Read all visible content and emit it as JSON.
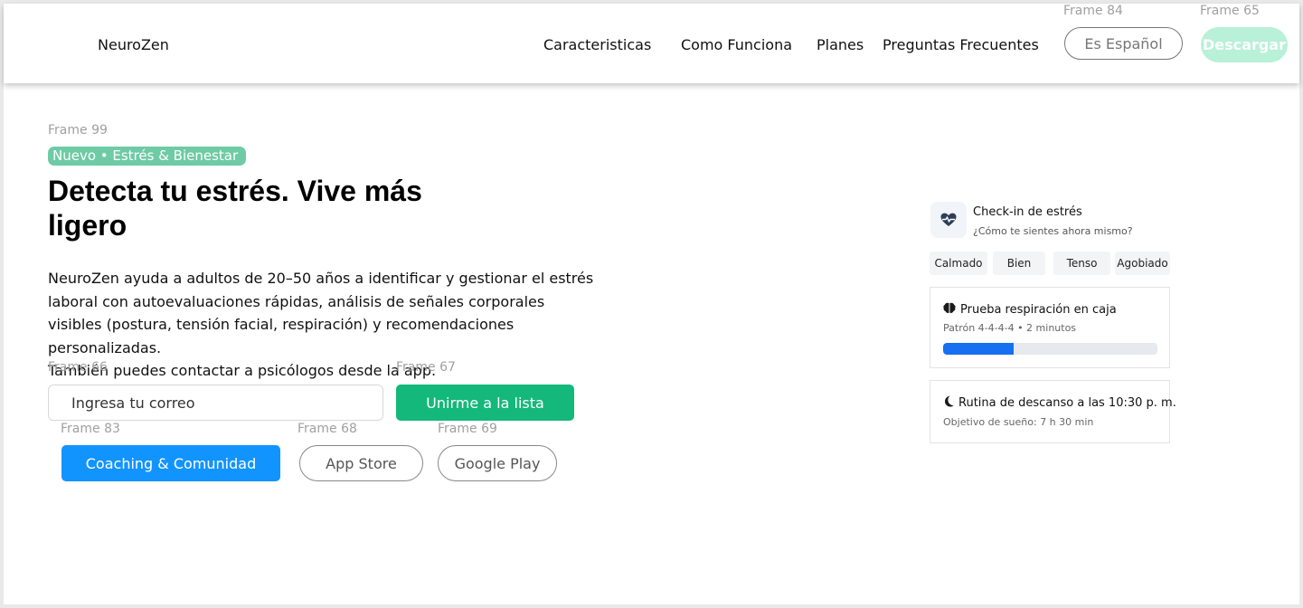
{
  "header": {
    "brand": "NeuroZen",
    "nav": [
      "Caracteristicas",
      "Como Funciona",
      "Planes",
      "Preguntas Frecuentes"
    ],
    "language_button": "Es Español",
    "download_button": "Descargar",
    "frame_labels": [
      "Frame 84",
      "Frame 65"
    ]
  },
  "hero": {
    "frame_label": "Frame 99",
    "badge": "Nuevo • Estrés & Bienestar",
    "headline_line1": "Detecta tu estrés. Vive más",
    "headline_line2": "ligero",
    "description": [
      "NeuroZen ayuda a adultos de 20–50 años a identificar y gestionar el estrés",
      "laboral con autoevaluaciones rápidas, análisis de señales corporales",
      "visibles (postura, tensión facial, respiración) y recomendaciones personalizadas.",
      "También puedes contactar a psicólogos desde la app."
    ],
    "email_frame_label": "Frame 66",
    "email_placeholder": "Ingresa tu correo",
    "join_frame_label": "Frame 67",
    "join_button": "Unirme a la lista",
    "coaching_frame_label": "Frame 83",
    "coaching_button": "Coaching & Comunidad",
    "appstore_frame_label": "Frame 68",
    "appstore_button": "App Store",
    "googleplay_frame_label": "Frame 69",
    "googleplay_button": "Google Play"
  },
  "checkin": {
    "title": "Check-in de estrés",
    "subtitle": "¿Cómo te sientes ahora mismo?",
    "icon": "heart-pulse-icon",
    "moods": [
      "Calmado",
      "Bien",
      "Tenso",
      "Agobiado"
    ],
    "breathing": {
      "title": "Prueba respiración en caja",
      "icon": "brain-icon",
      "subtitle": "Patrón 4-4-4-4 • 2 minutos",
      "progress": 0.33
    },
    "rest": {
      "title": "Rutina de descanso a las 10:30 p. m.",
      "icon": "moon-icon",
      "subtitle": "Objetivo de sueño: 7 h 30 min"
    }
  },
  "colors": {
    "accent_green": "#14b87a",
    "badge_green": "#6ecba5",
    "download_mint": "#b8f0d8",
    "primary_blue": "#1294ff",
    "progress_blue": "#1670f0"
  }
}
